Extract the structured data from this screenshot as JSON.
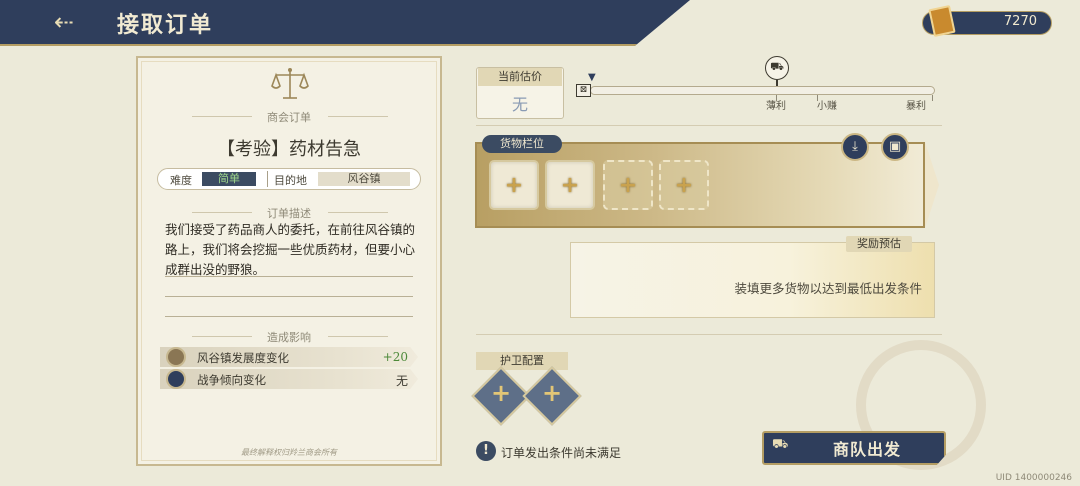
{
  "header": {
    "title": "接取订单"
  },
  "currency": {
    "value": "7270"
  },
  "order": {
    "category": "商会订单",
    "title": "【考验】药材告急",
    "difficulty_label": "难度",
    "difficulty_value": "简单",
    "destination_label": "目的地",
    "destination_value": "风谷镇",
    "description_header": "订单描述",
    "description": "我们接受了药品商人的委托，在前往风谷镇的路上，我们将会挖掘一些优质药材，但要小心成群出没的野狼。",
    "effects_header": "造成影响",
    "effects": [
      {
        "label": "风谷镇发展度变化",
        "value": "+20",
        "icon": "development-icon"
      },
      {
        "label": "战争倾向变化",
        "value": "无",
        "icon": "war-tendency-icon"
      }
    ],
    "footnote": "最终解释权归羚兰商会所有"
  },
  "valuation": {
    "label": "当前估价",
    "value": "无",
    "ticks": [
      "薄利",
      "小赚",
      "暴利"
    ]
  },
  "cargo": {
    "label": "货物栏位",
    "slots": [
      "filled",
      "filled",
      "empty",
      "empty"
    ]
  },
  "reward": {
    "label": "奖励预估",
    "text": "装填更多货物以达到最低出发条件"
  },
  "escort": {
    "label": "护卫配置",
    "slots": 2
  },
  "footer": {
    "warning": "订单发出条件尚未满足",
    "depart_label": "商队出发",
    "uid": "UID 1400000246"
  },
  "colors": {
    "navy": "#2f3e5c",
    "gold": "#b49d63",
    "parchment": "#ecead9",
    "easy_green": "#9fd88b",
    "positive": "#4d8a3a"
  }
}
